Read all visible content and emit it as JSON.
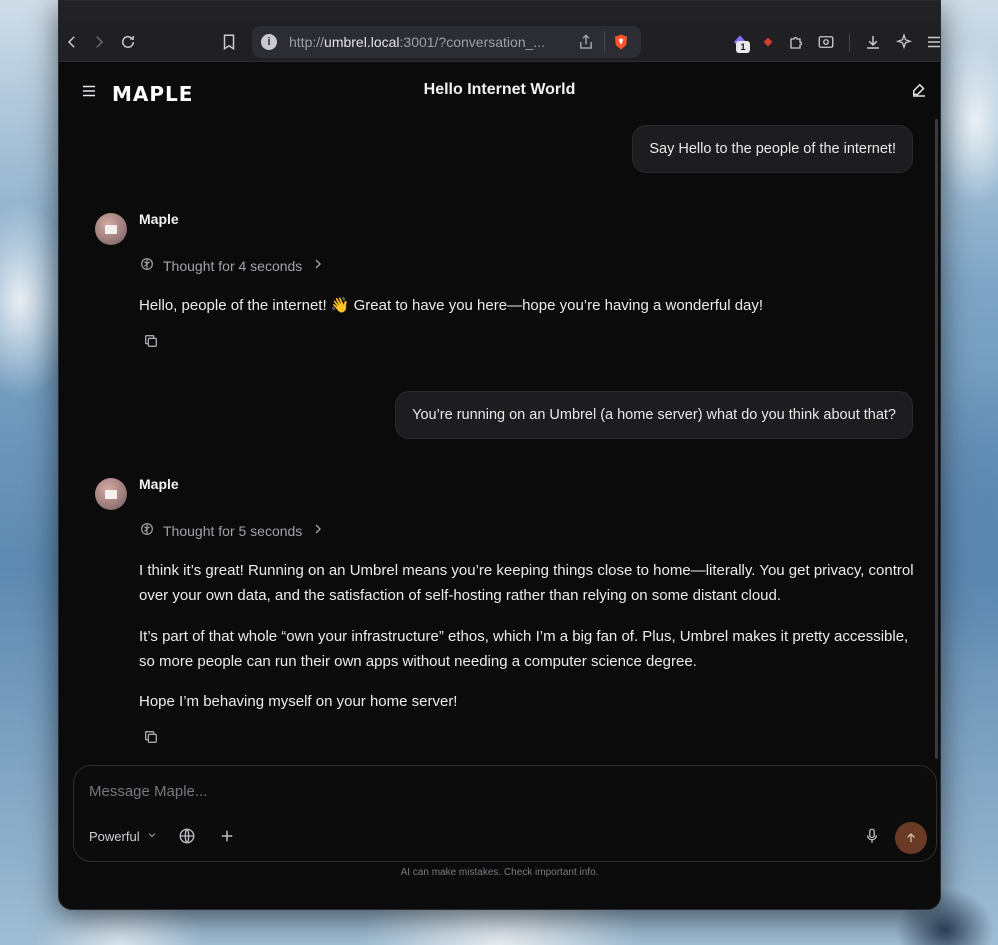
{
  "browser": {
    "url_prefix": "http://",
    "url_host": "umbrel.local",
    "url_rest": ":3001/?conversation_...",
    "extension_badge": "1"
  },
  "app": {
    "logo": "MAPLE",
    "title": "Hello Internet World"
  },
  "messages": {
    "user1": "Say Hello to the people of the internet!",
    "assistant1_sender": "Maple",
    "assistant1_thought": "Thought for 4 seconds",
    "assistant1_text": "Hello, people of the internet! 👋 Great to have you here—hope you’re having a wonderful day!",
    "user2": "You’re running on an Umbrel (a home server) what do you think about that?",
    "assistant2_sender": "Maple",
    "assistant2_thought": "Thought for 5 seconds",
    "assistant2_p1": "I think it’s great! Running on an Umbrel means you’re keeping things close to home—literally. You get privacy, control over your own data, and the satisfaction of self-hosting rather than relying on some distant cloud.",
    "assistant2_p2": "It’s part of that whole “own your infrastructure” ethos, which I’m a big fan of. Plus, Umbrel makes it pretty accessible, so more people can run their own apps without needing a computer science degree.",
    "assistant2_p3": "Hope I’m behaving myself on your home server!"
  },
  "composer": {
    "placeholder": "Message Maple...",
    "model": "Powerful",
    "disclaimer": "AI can make mistakes. Check important info."
  },
  "colors": {
    "send_button": "#6b3a26",
    "background": "#0b0b0c"
  }
}
